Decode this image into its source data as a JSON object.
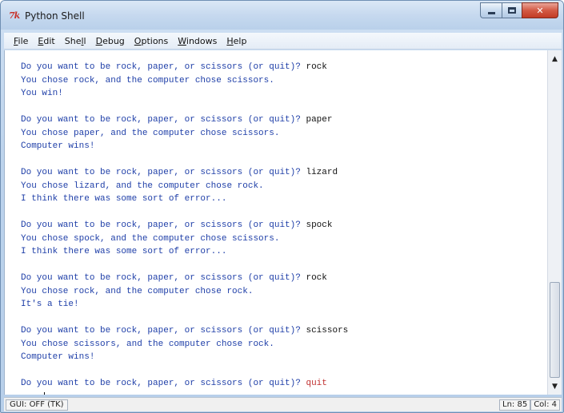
{
  "window": {
    "title": "Python Shell",
    "icon": "tk-icon",
    "controls": {
      "minimize": "minimize-icon",
      "maximize": "maximize-icon",
      "close": "close-icon",
      "close_glyph": "✕"
    }
  },
  "menu": [
    {
      "id": "file",
      "mnemonic": "F",
      "rest": "ile"
    },
    {
      "id": "edit",
      "mnemonic": "E",
      "rest": "dit"
    },
    {
      "id": "shell",
      "pre": "She",
      "mnemonic": "l",
      "rest": "l"
    },
    {
      "id": "debug",
      "mnemonic": "D",
      "rest": "ebug"
    },
    {
      "id": "options",
      "mnemonic": "O",
      "rest": "ptions"
    },
    {
      "id": "windows",
      "mnemonic": "W",
      "rest": "indows"
    },
    {
      "id": "help",
      "mnemonic": "H",
      "rest": "elp"
    }
  ],
  "transcript": [
    {
      "question": "Do you want to be rock, paper, or scissors (or quit)? ",
      "input": "rock",
      "result": "You chose rock, and the computer chose scissors.",
      "outcome": "You win!"
    },
    {
      "question": "Do you want to be rock, paper, or scissors (or quit)? ",
      "input": "paper",
      "result": "You chose paper, and the computer chose scissors.",
      "outcome": "Computer wins!"
    },
    {
      "question": "Do you want to be rock, paper, or scissors (or quit)? ",
      "input": "lizard",
      "result": "You chose lizard, and the computer chose rock.",
      "outcome": "I think there was some sort of error..."
    },
    {
      "question": "Do you want to be rock, paper, or scissors (or quit)? ",
      "input": "spock",
      "result": "You chose spock, and the computer chose scissors.",
      "outcome": "I think there was some sort of error..."
    },
    {
      "question": "Do you want to be rock, paper, or scissors (or quit)? ",
      "input": "rock",
      "result": "You chose rock, and the computer chose rock.",
      "outcome": "It's a tie!"
    },
    {
      "question": "Do you want to be rock, paper, or scissors (or quit)? ",
      "input": "scissors",
      "result": "You chose scissors, and the computer chose rock.",
      "outcome": "Computer wins!"
    }
  ],
  "final_line": {
    "question": "Do you want to be rock, paper, or scissors (or quit)? ",
    "input": "quit"
  },
  "prompt": ">>> ",
  "scrollbar": {
    "up": "▲",
    "down": "▼"
  },
  "status": {
    "left": "GUI: OFF (TK)",
    "line": "Ln: 85",
    "col": "Col: 4"
  }
}
